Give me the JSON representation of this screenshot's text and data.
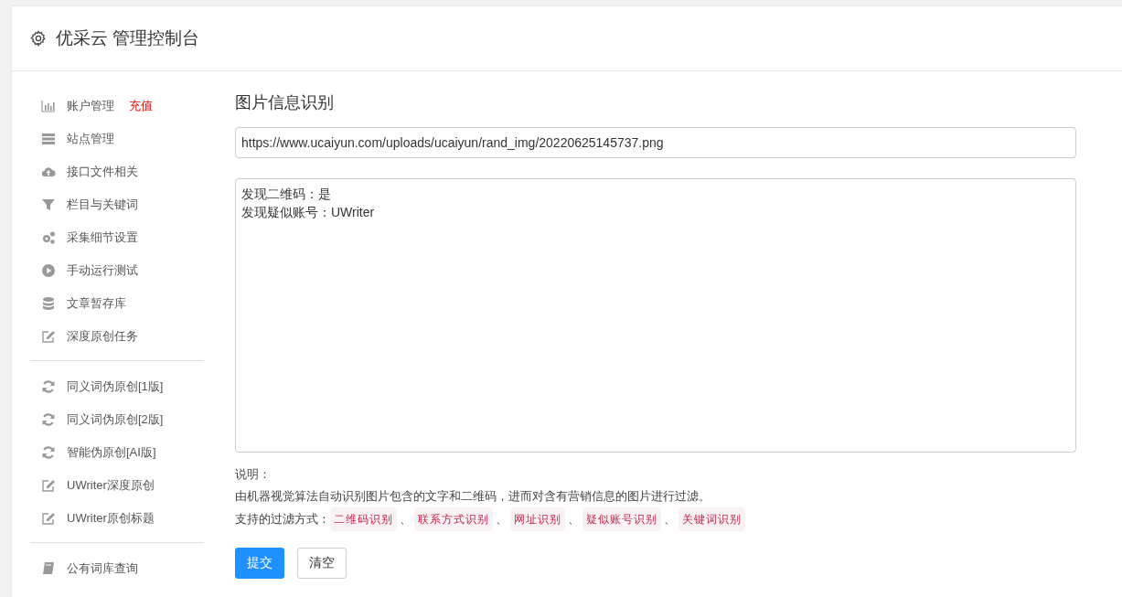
{
  "header": {
    "title": "优采云 管理控制台"
  },
  "sidebar": {
    "groups": [
      [
        {
          "kind": "chart",
          "label": "账户管理",
          "badge": "充值"
        },
        {
          "kind": "server",
          "label": "站点管理"
        },
        {
          "kind": "cloud",
          "label": "接口文件相关"
        },
        {
          "kind": "filter",
          "label": "栏目与关键词"
        },
        {
          "kind": "gears",
          "label": "采集细节设置"
        },
        {
          "kind": "play",
          "label": "手动运行测试"
        },
        {
          "kind": "database",
          "label": "文章暂存库"
        },
        {
          "kind": "edit",
          "label": "深度原创任务"
        }
      ],
      [
        {
          "kind": "refresh",
          "label": "同义词伪原创[1版]"
        },
        {
          "kind": "refresh",
          "label": "同义词伪原创[2版]"
        },
        {
          "kind": "refresh",
          "label": "智能伪原创[AI版]"
        },
        {
          "kind": "edit",
          "label": "UWriter深度原创"
        },
        {
          "kind": "edit",
          "label": "UWriter原创标题"
        }
      ],
      [
        {
          "kind": "book",
          "label": "公有词库查询"
        }
      ]
    ]
  },
  "main": {
    "heading": "图片信息识别",
    "url_field": {
      "value": "https://www.ucaiyun.com/uploads/ucaiyun/rand_img/20220625145737.png"
    },
    "result_box": {
      "lines": [
        "发现二维码：是",
        "发现疑似账号：UWriter"
      ]
    },
    "note_label": "说明：",
    "note_text": "由机器视觉算法自动识别图片包含的文字和二维码，进而对含有营销信息的图片进行过滤。",
    "filters_label": "支持的过滤方式：",
    "filters": [
      "二维码识别",
      "联系方式识别",
      "网址识别",
      "疑似账号识别",
      "关键词识别"
    ],
    "separator": "、",
    "buttons": [
      {
        "label": "提交",
        "kind": "primary"
      },
      {
        "label": "清空",
        "kind": "default"
      }
    ]
  }
}
